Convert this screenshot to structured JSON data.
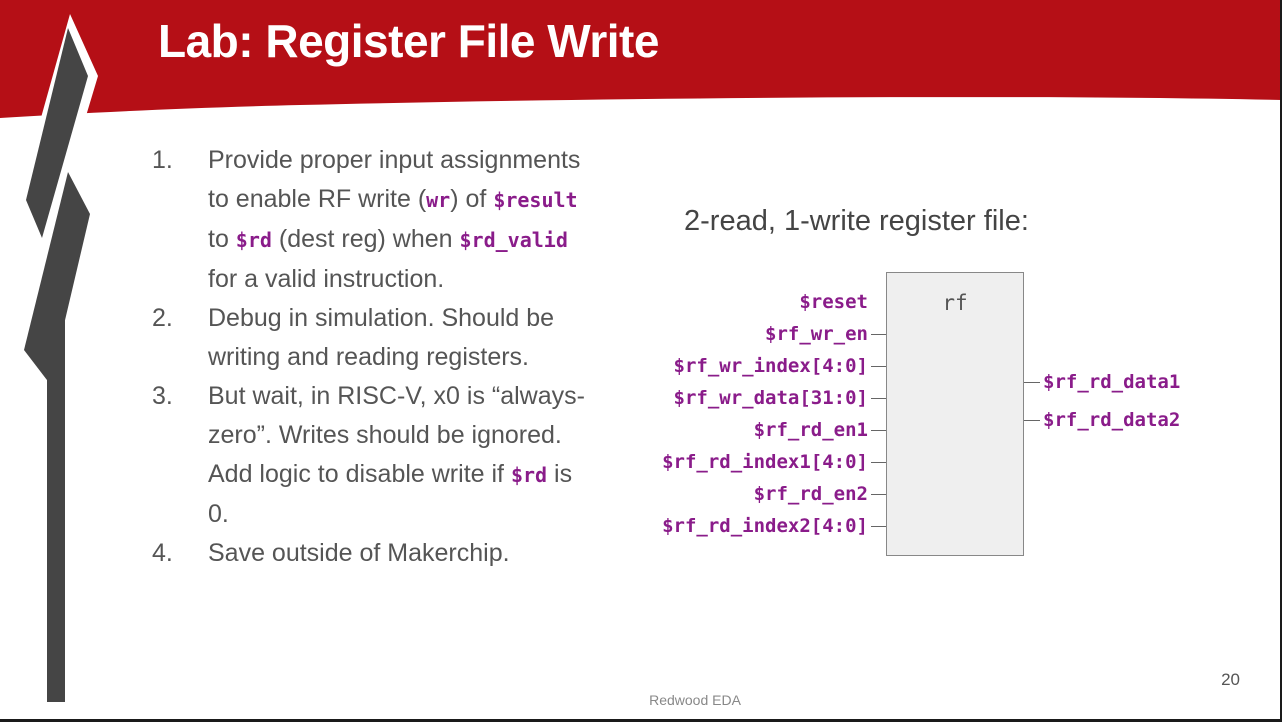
{
  "slide": {
    "title": "Lab: Register File Write",
    "page_number": "20",
    "footer": "Redwood EDA",
    "accent_color": "#b50f16"
  },
  "steps": [
    {
      "number": "1.",
      "parts": [
        {
          "t": "Provide proper input assignments to enable RF write ("
        },
        {
          "c": "wr"
        },
        {
          "t": ") of "
        },
        {
          "c": "$result"
        },
        {
          "t": " to "
        },
        {
          "c": "$rd"
        },
        {
          "t": " (dest reg) when "
        },
        {
          "c": "$rd_valid"
        },
        {
          "t": " for a valid instruction."
        }
      ]
    },
    {
      "number": "2.",
      "parts": [
        {
          "t": "Debug in simulation. Should be writing and reading registers."
        }
      ]
    },
    {
      "number": "3.",
      "parts": [
        {
          "t": "But wait, in RISC-V, x0 is “always-zero”. Writes should be ignored. Add logic to disable write if "
        },
        {
          "c": "$rd"
        },
        {
          "t": " is 0."
        }
      ]
    },
    {
      "number": "4.",
      "parts": [
        {
          "t": "Save outside of Makerchip."
        }
      ]
    }
  ],
  "diagram": {
    "title": "2-read, 1-write register file:",
    "block_label": "rf",
    "inputs": [
      {
        "label": "$reset",
        "wire": false
      },
      {
        "label": "$rf_wr_en",
        "wire": true
      },
      {
        "label": "$rf_wr_index[4:0]",
        "wire": true
      },
      {
        "label": "$rf_wr_data[31:0]",
        "wire": true
      },
      {
        "label": "$rf_rd_en1",
        "wire": true
      },
      {
        "label": "$rf_rd_index1[4:0]",
        "wire": true
      },
      {
        "label": "$rf_rd_en2",
        "wire": true
      },
      {
        "label": "$rf_rd_index2[4:0]",
        "wire": true
      }
    ],
    "outputs": [
      {
        "label": "$rf_rd_data1"
      },
      {
        "label": "$rf_rd_data2"
      }
    ]
  }
}
